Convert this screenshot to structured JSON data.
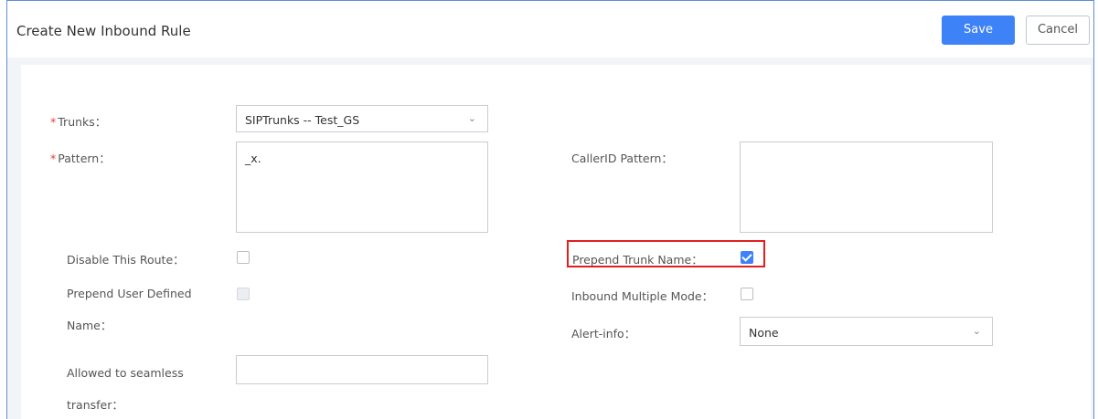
{
  "header": {
    "title": "Create New Inbound Rule",
    "save_label": "Save",
    "cancel_label": "Cancel"
  },
  "form": {
    "required_mark": "*",
    "trunks": {
      "label": "Trunks：",
      "value": "SIPTrunks -- Test_GS"
    },
    "pattern": {
      "label": "Pattern：",
      "value": "_x."
    },
    "callerid_pattern": {
      "label": "CallerID Pattern：",
      "value": ""
    },
    "disable_route": {
      "label": "Disable This Route：",
      "checked": false
    },
    "prepend_trunk_name": {
      "label": "Prepend Trunk Name：",
      "checked": true
    },
    "prepend_user_defined": {
      "label_line1": "Prepend User Defined",
      "label_line2": "Name：",
      "checked": false,
      "disabled": true
    },
    "inbound_multiple_mode": {
      "label": "Inbound Multiple Mode：",
      "checked": false
    },
    "alert_info": {
      "label": "Alert-info：",
      "value": "None"
    },
    "seamless_transfer": {
      "label_line1": "Allowed to seamless",
      "label_line2": "transfer：",
      "value": ""
    }
  },
  "icons": {
    "dropdown": "chevron-down-icon",
    "checked": "checkmark-icon"
  },
  "colors": {
    "primary": "#3e82f7",
    "required": "#e83c3c",
    "highlight": "#e02020"
  }
}
